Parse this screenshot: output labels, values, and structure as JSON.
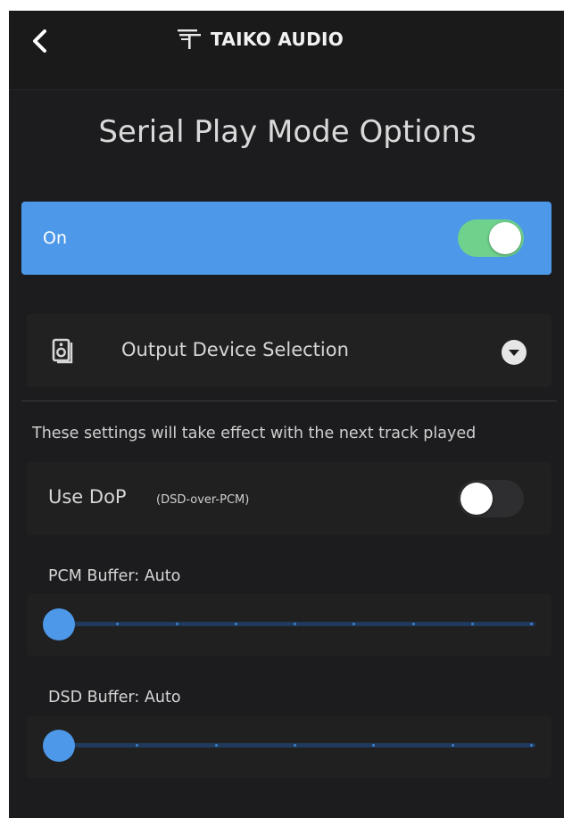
{
  "header": {
    "back_icon": "chevron-left-icon",
    "brand_icon": "taiko-logo-icon",
    "brand_text": "TAIKO AUDIO"
  },
  "page": {
    "title": "Serial Play Mode Options"
  },
  "master_toggle": {
    "label": "On",
    "state": true,
    "row_color": "#4d98e8",
    "switch_on_color": "#6fd18c"
  },
  "output_device": {
    "icon": "speaker-icon",
    "label": "Output Device Selection",
    "dropdown_icon": "chevron-down-circle-icon"
  },
  "notice": "These settings will take effect with the next track played",
  "dop": {
    "label": "Use DoP",
    "sublabel": "(DSD-over-PCM)",
    "state": false
  },
  "pcm_buffer": {
    "label": "PCM Buffer: Auto",
    "value": 0,
    "steps": 8
  },
  "dsd_buffer": {
    "label": "DSD Buffer: Auto",
    "value": 0,
    "steps": 6
  },
  "colors": {
    "background": "#1c1c1e",
    "accent": "#4d98e8",
    "text": "#d6d6d6"
  }
}
